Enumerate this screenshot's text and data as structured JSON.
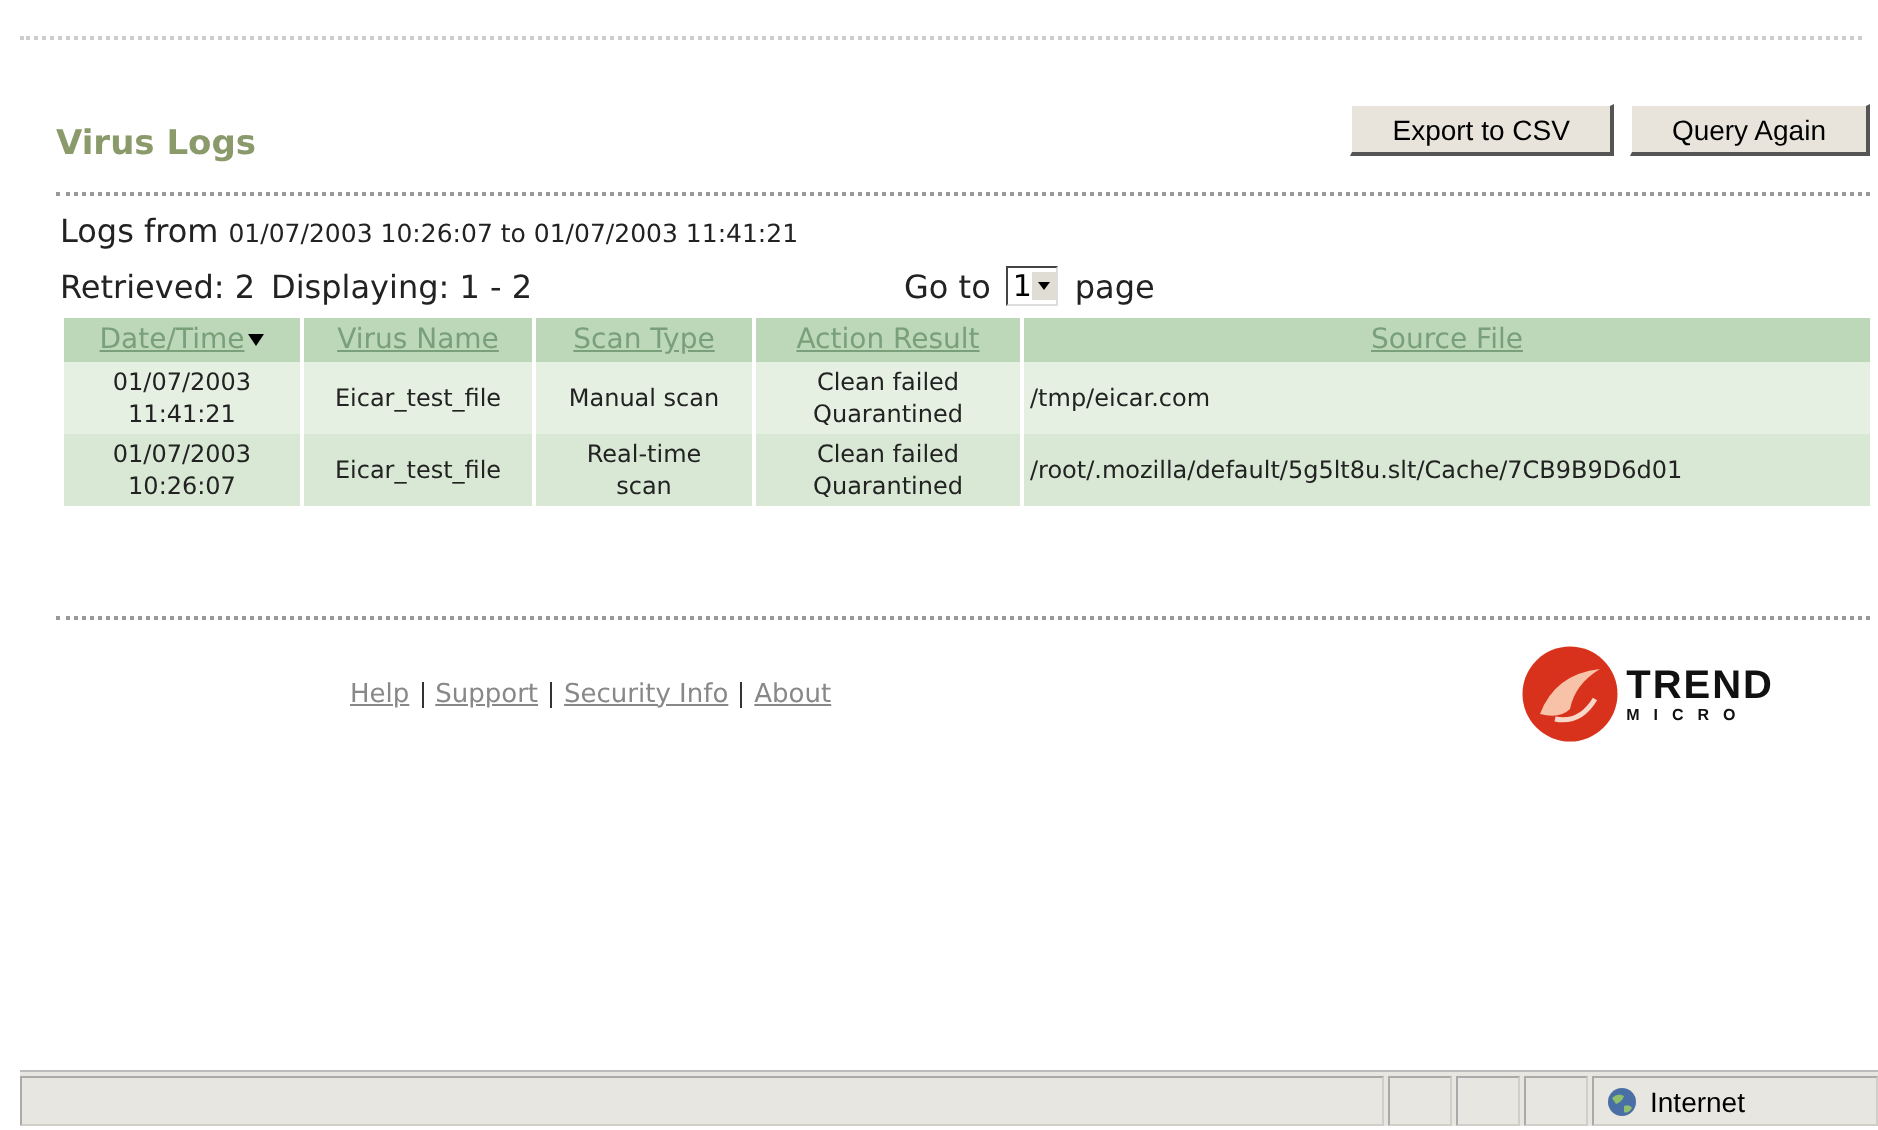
{
  "title": "Virus Logs",
  "buttons": [
    "Export to CSV",
    "Query Again"
  ],
  "logs_range": {
    "label": "Logs from",
    "range": "01/07/2003 10:26:07 to 01/07/2003 11:41:21"
  },
  "summary": {
    "retrieved": "Retrieved: 2",
    "displaying": "Displaying: 1 - 2"
  },
  "pager": {
    "prefix": "Go to",
    "value": "1",
    "suffix": "page"
  },
  "table": {
    "columns": [
      {
        "label": "Date/Time",
        "sorted": true
      },
      {
        "label": "Virus Name",
        "sorted": false
      },
      {
        "label": "Scan Type",
        "sorted": false
      },
      {
        "label": "Action Result",
        "sorted": false
      },
      {
        "label": "Source File",
        "sorted": false
      }
    ],
    "rows": [
      [
        "01/07/2003\n11:41:21",
        "Eicar_test_file",
        "Manual scan",
        "Clean failed\nQuarantined",
        "/tmp/eicar.com"
      ],
      [
        "01/07/2003\n10:26:07",
        "Eicar_test_file",
        "Real-time\nscan",
        "Clean failed\nQuarantined",
        "/root/.mozilla/default/5g5lt8u.slt/Cache/7CB9B9D6d01"
      ]
    ]
  },
  "footer_links": [
    "Help",
    "Support",
    "Security Info",
    "About"
  ],
  "logo": {
    "word": "TREND",
    "sub": "MICRO"
  },
  "status_bar": {
    "zone": "Internet"
  }
}
